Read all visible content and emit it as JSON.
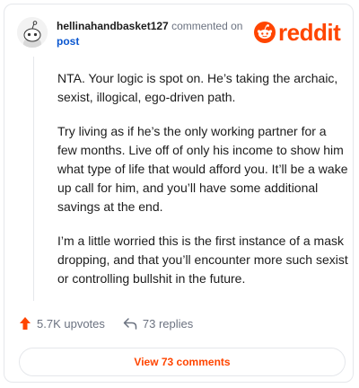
{
  "header": {
    "username": "hellinahandbasket127",
    "action_text": "commented on",
    "link_text": "post"
  },
  "brand": {
    "name": "reddit",
    "color": "#ff4500"
  },
  "comment": {
    "paragraphs": [
      "NTA. Your logic is spot on. He’s taking the archaic, sexist, illogical, ego-driven path.",
      "Try living as if he’s the only working partner for a few months. Live off of only his income to show him what type of life that would afford you. It’ll be a wake up call for him, and you’ll have some additional savings at the end.",
      "I’m a little worried this is the first instance of a mask dropping, and that you’ll encounter more such sexist or controlling bullshit in the future."
    ]
  },
  "actions": {
    "upvotes": "5.7K upvotes",
    "replies": "73 replies",
    "upvote_icon": "upvote-arrow-icon",
    "reply_icon": "reply-arrow-icon"
  },
  "footer": {
    "view_button": "View 73 comments"
  }
}
